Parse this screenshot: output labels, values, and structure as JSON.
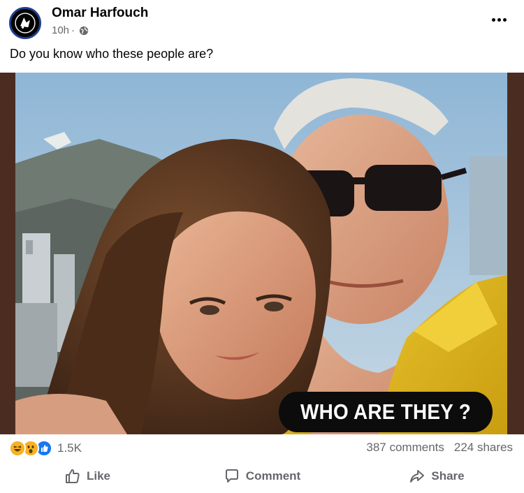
{
  "post": {
    "author": "Omar Harfouch",
    "time": "10h",
    "separator": "·",
    "text": "Do you know who these people are?",
    "image_caption": "WHO ARE THEY ?"
  },
  "stats": {
    "reaction_icons": [
      "haha-icon",
      "wow-icon",
      "like-icon"
    ],
    "reaction_count": "1.5K",
    "comments": "387 comments",
    "shares": "224 shares"
  },
  "actions": {
    "like_label": "Like",
    "comment_label": "Comment",
    "share_label": "Share"
  },
  "colors": {
    "secondary_text": "#65676b",
    "frame_brown": "#4a2d20",
    "like_blue": "#1877f2",
    "reaction_yellow": "#f7b125"
  }
}
